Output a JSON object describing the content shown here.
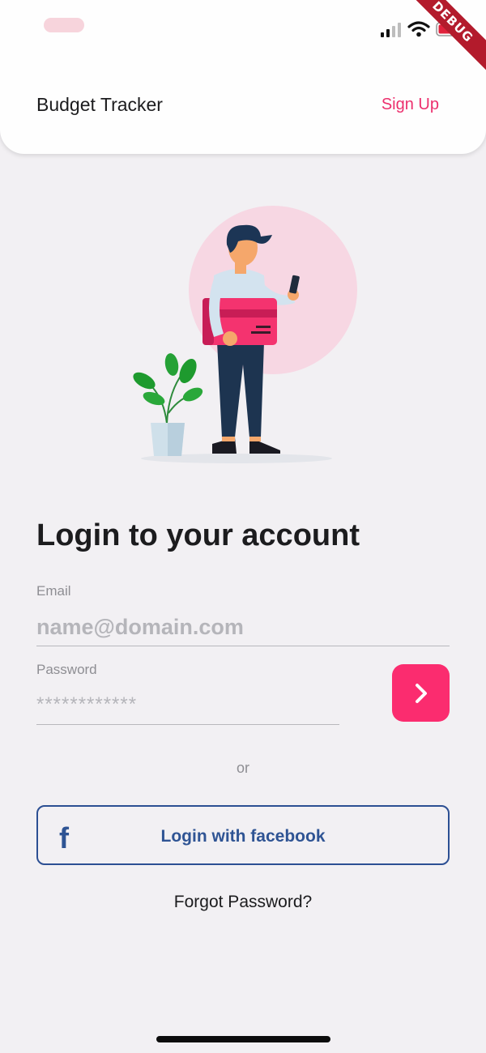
{
  "status_bar": {
    "debug_label": "DEBUG"
  },
  "app_bar": {
    "title": "Budget Tracker",
    "signup_label": "Sign Up"
  },
  "login": {
    "title": "Login to your account",
    "email_label": "Email",
    "email_placeholder": "name@domain.com",
    "password_label": "Password",
    "password_placeholder": "************",
    "or_label": "or",
    "facebook_icon_glyph": "f",
    "facebook_label": "Login with facebook",
    "forgot_label": "Forgot Password?"
  },
  "colors": {
    "accent": "#fb2c6f",
    "link": "#ec2f6d",
    "facebook": "#2f5494",
    "background": "#f2f0f3"
  },
  "icons": [
    "signal-icon",
    "wifi-icon",
    "battery-icon",
    "chevron-right-icon",
    "facebook-icon"
  ]
}
